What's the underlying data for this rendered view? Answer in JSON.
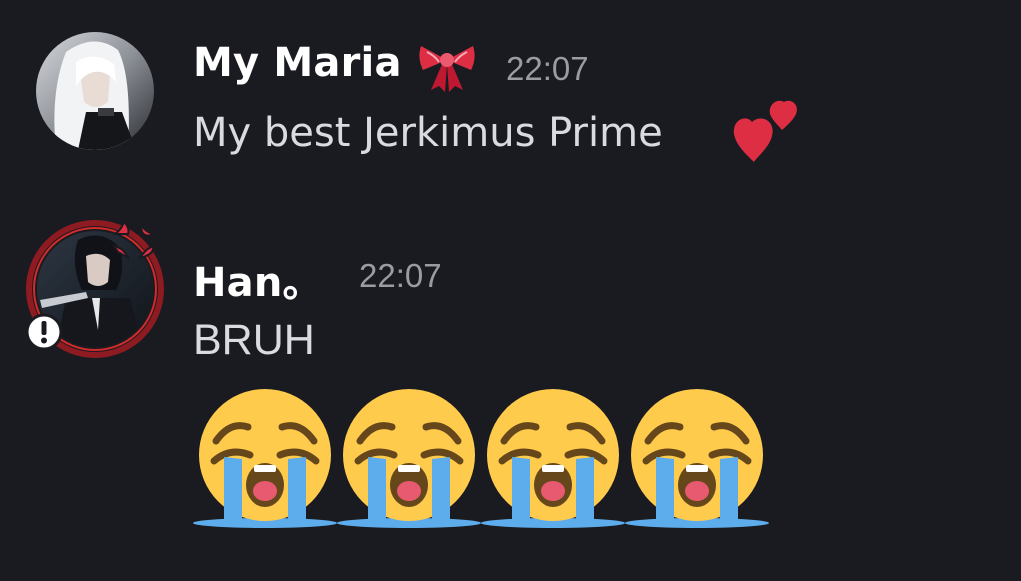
{
  "messages": [
    {
      "username": "My Maria",
      "username_emoji": "ribbon-icon",
      "timestamp": "22:07",
      "text": "My best Jerkimus Prime",
      "trailing_emoji": "two-hearts-icon"
    },
    {
      "username": "Han。",
      "timestamp": "22:07",
      "text": "BRUH",
      "avatar_decoration": [
        "anger-symbol-icon",
        "exclamation-badge-icon",
        "red-ring"
      ],
      "emojis": [
        "loudly-crying-face-icon",
        "loudly-crying-face-icon",
        "loudly-crying-face-icon",
        "loudly-crying-face-icon"
      ]
    }
  ],
  "colors": {
    "background": "#1a1b20",
    "username": "#ffffff",
    "timestamp": "#9a9ca3",
    "message_text": "#d9dbe0",
    "heart": "#dd2e44",
    "emoji_face": "#ffcb4c",
    "tears": "#5dadec"
  }
}
